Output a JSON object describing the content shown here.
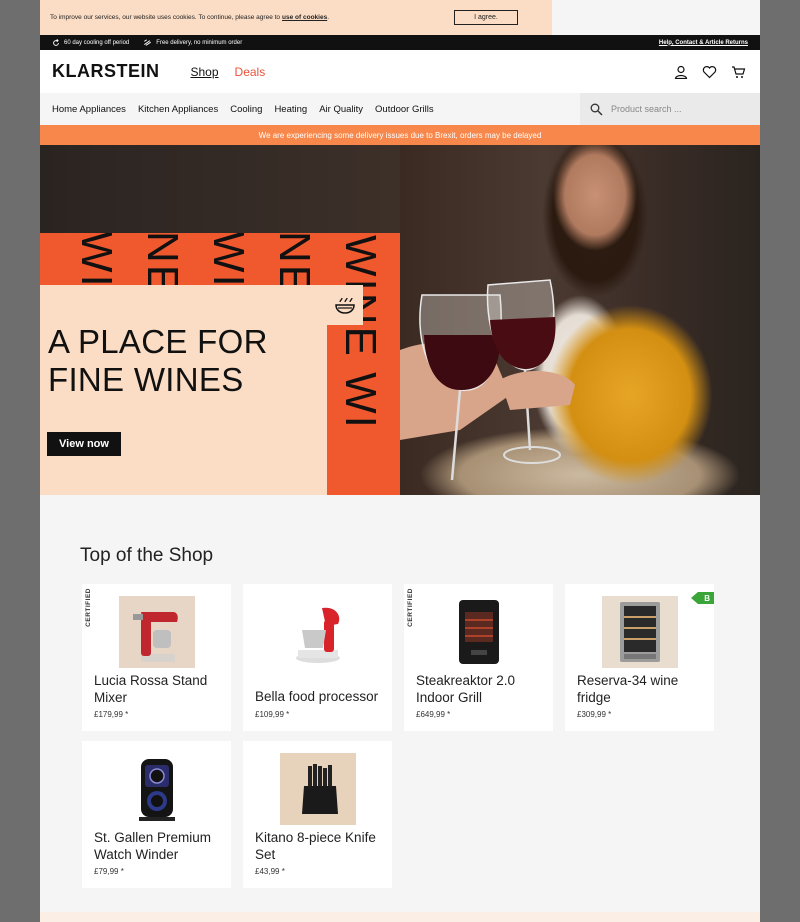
{
  "cookie_bar": {
    "text": "To improve our services, our website uses cookies. To continue, please agree to",
    "link": "use of cookies",
    "suffix": ".",
    "button": "I agree."
  },
  "info_bar": {
    "cooling_off": "60 day cooling off period",
    "free_delivery": "Free delivery, no minimum order",
    "help": "Help, Contact & Article Returns"
  },
  "header": {
    "logo": "KLARSTEIN",
    "nav": [
      "Shop",
      "Deals"
    ],
    "icons": [
      "user-icon",
      "heart-icon",
      "cart-icon"
    ]
  },
  "categories": [
    "Home Appliances",
    "Kitchen Appliances",
    "Cooling",
    "Heating",
    "Air Quality",
    "Outdoor Grills"
  ],
  "search": {
    "placeholder": "Product search ..."
  },
  "notice": "We are experiencing some delivery issues due to Brexit, orders may be delayed",
  "hero": {
    "deco_words": [
      "WINE WI",
      "NE",
      "WI",
      "NE",
      "WI"
    ],
    "title_line1": "A PLACE FOR",
    "title_line2": "FINE WINES",
    "button": "View now"
  },
  "shop": {
    "title": "Top of the Shop",
    "certified_label": "CERTIFIED",
    "products": [
      {
        "name": "Lucia Rossa Stand Mixer",
        "price": "£179,99 *",
        "certified": true,
        "energy": ""
      },
      {
        "name": "Bella food processor",
        "price": "£109,99 *",
        "certified": false,
        "energy": ""
      },
      {
        "name": "Steakreaktor 2.0 Indoor Grill",
        "price": "£649,99 *",
        "certified": true,
        "energy": ""
      },
      {
        "name": "Reserva-34 wine fridge",
        "price": "£309,99 *",
        "certified": false,
        "energy": "B"
      },
      {
        "name": "St. Gallen Premium Watch Winder",
        "price": "£79,99 *",
        "certified": false,
        "energy": ""
      },
      {
        "name": "Kitano 8-piece Knife Set",
        "price": "£43,99 *",
        "certified": false,
        "energy": ""
      }
    ]
  },
  "colors": {
    "accent_orange": "#f0582e",
    "notice_orange": "#f7874a",
    "peach": "#fbddc5",
    "deals_red": "#e8543a",
    "energy_green": "#3aa63a"
  }
}
